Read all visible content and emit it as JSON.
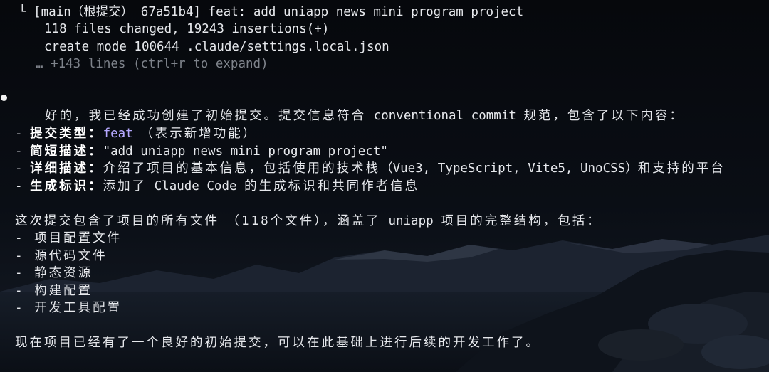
{
  "git_output": {
    "branch_prefix": "└ [main（根提交） 67a51b4] feat: add uniapp news mini program project",
    "files_changed": "118 files changed, 19243 insertions(+)",
    "create_mode": "create mode 100644 .claude/settings.local.json",
    "collapsed": "… +143 lines (ctrl+r to expand)"
  },
  "message": {
    "intro_cn": "好的，我已经成功创建了初始提交。提交信息符合",
    "intro_term": "conventional commit",
    "intro_tail": "规范，包含了以下内容：",
    "details": [
      {
        "dash": "- ",
        "label": "提交类型：",
        "value": "feat",
        "note": "（表示新增功能）"
      },
      {
        "dash": "- ",
        "label": "简短描述：",
        "value": "\"add uniapp news mini program project\""
      },
      {
        "dash": "- ",
        "label": "详细描述：",
        "value_cn": "介绍了项目的基本信息，包括使用的技术栈",
        "value_en": "（Vue3, TypeScript, Vite5, UnoCSS）",
        "value_tail": "和支持的平台"
      },
      {
        "dash": "- ",
        "label": "生成标识：",
        "value_cn": "添加了",
        "value_en": "Claude Code",
        "value_tail": "的生成标识和共同作者信息"
      }
    ],
    "scope_a": "这次提交包含了项目的所有文件",
    "scope_b": "（118个文件），涵盖了",
    "scope_c": "uniapp",
    "scope_d": "项目的完整结构，包括：",
    "items": [
      "- 项目配置文件",
      "- 源代码文件",
      "- 静态资源",
      "- 构建配置",
      "- 开发工具配置"
    ],
    "closing": "现在项目已经有了一个良好的初始提交，可以在此基础上进行后续的开发工作了。"
  },
  "colors": {
    "text": "#e6e8ec",
    "dim": "#7e838b",
    "feat": "#b5a8ff",
    "background": "#07090d"
  }
}
